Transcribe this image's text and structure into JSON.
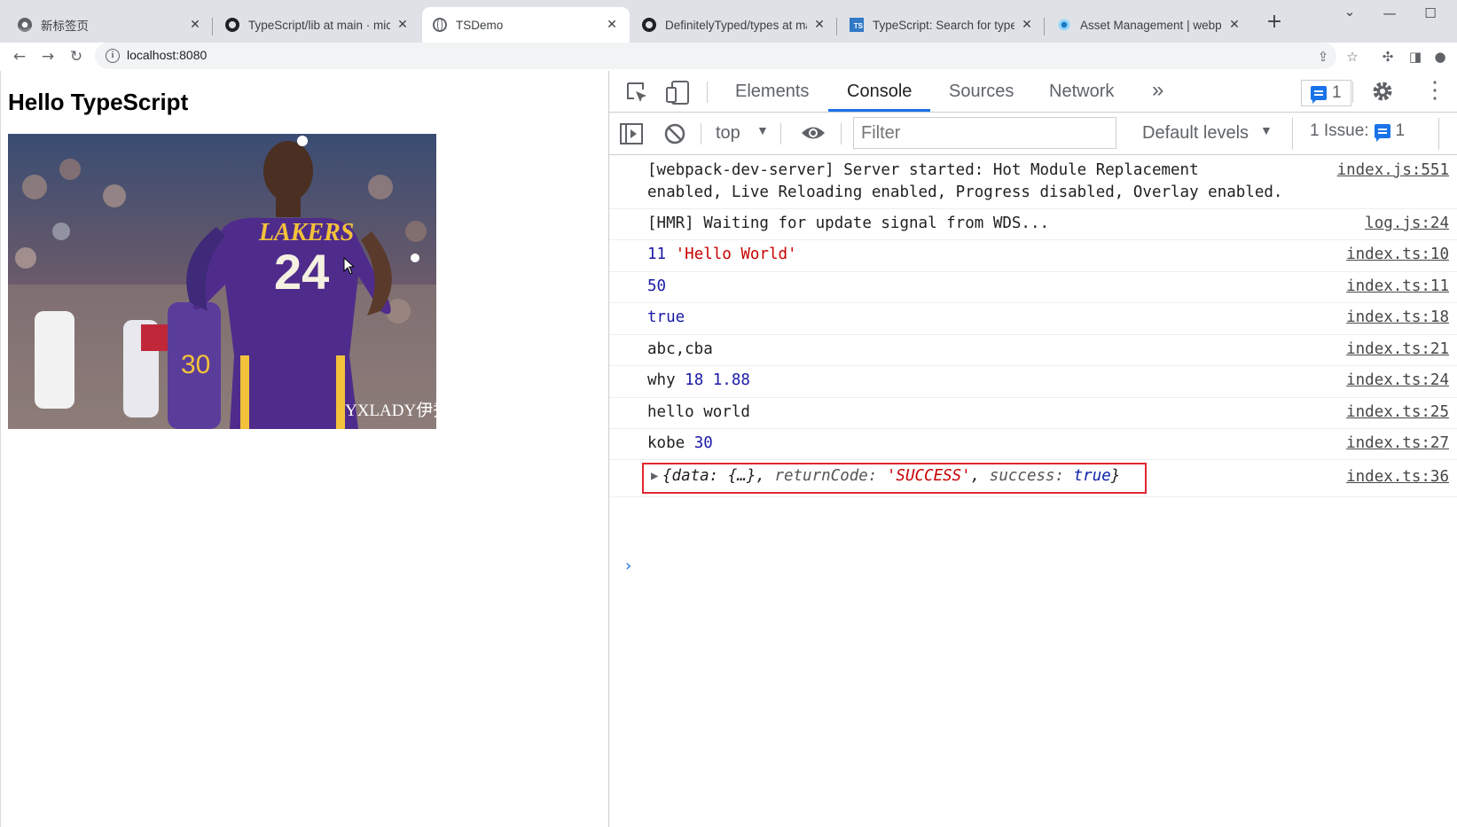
{
  "tabs": [
    {
      "title": "新标签页",
      "icon": "chrome-icon"
    },
    {
      "title": "TypeScript/lib at main · microsoft",
      "icon": "github-icon"
    },
    {
      "title": "TSDemo",
      "icon": "globe-icon"
    },
    {
      "title": "DefinitelyTyped/types at master",
      "icon": "github-icon"
    },
    {
      "title": "TypeScript: Search for typed packages",
      "icon": "typescript-icon"
    },
    {
      "title": "Asset Management | webpack",
      "icon": "webpack-icon"
    }
  ],
  "toolbar": {
    "url": "localhost:8080"
  },
  "page": {
    "heading": "Hello TypeScript",
    "image_watermark": "YXLADY伊秀.COM"
  },
  "devtools": {
    "tabs": [
      "Elements",
      "Console",
      "Sources",
      "Network"
    ],
    "active_tab": "Console",
    "message_count": "1",
    "context": "top",
    "filter_placeholder": "Filter",
    "levels": "Default levels",
    "issues_label": "1 Issue:",
    "issues_count": "1"
  },
  "console": {
    "rows": [
      {
        "line1": "[webpack-dev-server] Server started: Hot Module Replacement",
        "line2": "enabled, Live Reloading enabled, Progress disabled, Overlay enabled.",
        "source": "index.js:551"
      },
      {
        "text": "[HMR] Waiting for update signal from WDS...",
        "source": "log.js:24"
      },
      {
        "num": "11",
        "str": "'Hello World'",
        "source": "index.ts:10"
      },
      {
        "num": "50",
        "source": "index.ts:11"
      },
      {
        "num": "true",
        "source": "index.ts:18"
      },
      {
        "text": "abc,cba",
        "source": "index.ts:21"
      },
      {
        "text": "why",
        "num": "18 1.88",
        "source": "index.ts:24"
      },
      {
        "text": "hello world",
        "source": "index.ts:25"
      },
      {
        "text": "kobe",
        "num": "30",
        "source": "index.ts:27"
      },
      {
        "obj_open": "{data: {…}, ",
        "key1": "returnCode:",
        "val1": "'SUCCESS'",
        "key2": "success:",
        "val2": "true",
        "obj_close": "}",
        "source": "index.ts:36"
      }
    ]
  }
}
